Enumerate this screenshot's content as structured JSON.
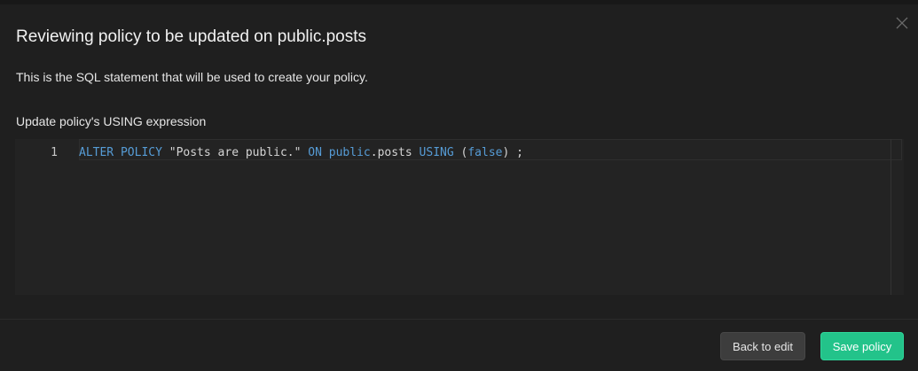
{
  "modal": {
    "title": "Reviewing policy to be updated on public.posts",
    "description": "This is the SQL statement that will be used to create your policy.",
    "section_label": "Update policy's USING expression",
    "close_icon": "close-icon"
  },
  "editor": {
    "line_number": "1",
    "tokens": [
      {
        "text": "ALTER POLICY",
        "kind": "keyword"
      },
      {
        "text": " \"Posts are public.\" ",
        "kind": "plain"
      },
      {
        "text": "ON",
        "kind": "keyword"
      },
      {
        "text": " ",
        "kind": "plain"
      },
      {
        "text": "public",
        "kind": "keyword"
      },
      {
        "text": ".posts ",
        "kind": "plain"
      },
      {
        "text": "USING",
        "kind": "keyword"
      },
      {
        "text": " (",
        "kind": "plain"
      },
      {
        "text": "false",
        "kind": "keyword"
      },
      {
        "text": ") ;",
        "kind": "plain"
      }
    ]
  },
  "footer": {
    "back_label": "Back to edit",
    "save_label": "Save policy"
  },
  "colors": {
    "keyword": "#569cd6",
    "accent_save": "#23c38a",
    "background": "#1f1f1f"
  }
}
